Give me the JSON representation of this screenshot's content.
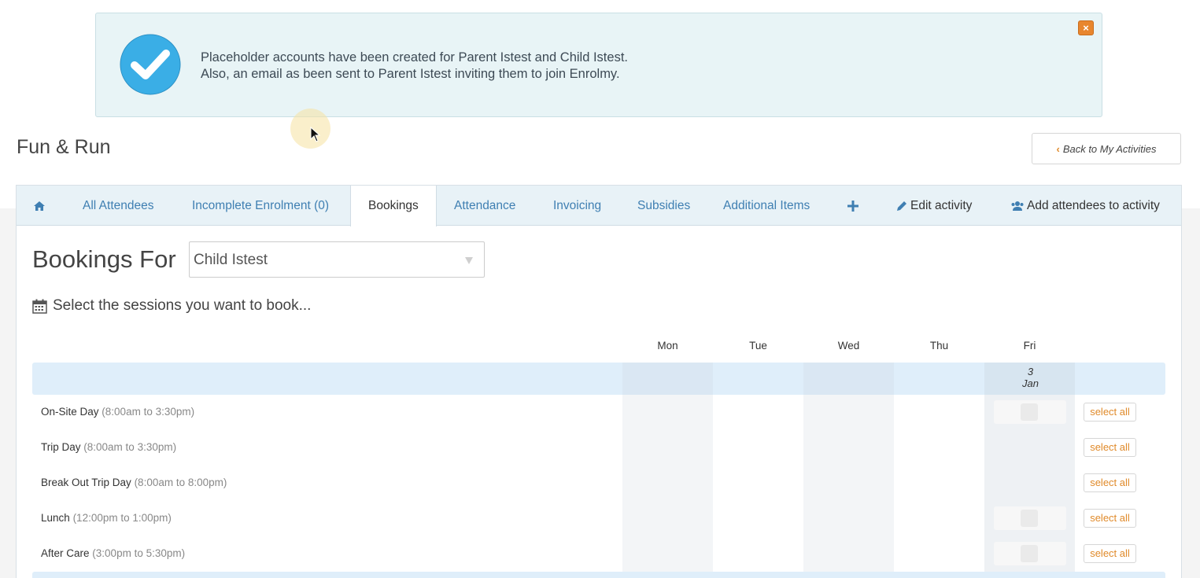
{
  "alert": {
    "line1": "Placeholder accounts have been created for Parent Istest and Child Istest.",
    "line2": "Also, an email as been sent to Parent Istest inviting them to join Enrolmy.",
    "close_label": "×",
    "icon": "check-circle-icon",
    "accent": "#3aaee6"
  },
  "header": {
    "title": "Fun & Run",
    "back_label": "Back to My Activities"
  },
  "tabs": [
    {
      "label": "All Attendees"
    },
    {
      "label": "Incomplete Enrolment (0)"
    },
    {
      "label": "Bookings"
    },
    {
      "label": "Attendance"
    },
    {
      "label": "Invoicing"
    },
    {
      "label": "Subsidies"
    },
    {
      "label": "Additional Items"
    },
    {
      "label": "Edit activity"
    },
    {
      "label": "Add attendees to activity"
    }
  ],
  "bookings": {
    "title": "Bookings For",
    "selected_child": "Child Istest",
    "instruction": "Select the sessions you want to book...",
    "days": [
      "Mon",
      "Tue",
      "Wed",
      "Thu",
      "Fri"
    ],
    "date": {
      "day": "3",
      "month": "Jan"
    },
    "select_all_label": "select all",
    "sessions": [
      {
        "name": "On-Site Day",
        "time": "(8:00am to 3:30pm)"
      },
      {
        "name": "Trip Day",
        "time": "(8:00am to 3:30pm)"
      },
      {
        "name": "Break Out Trip Day",
        "time": "(8:00am to 8:00pm)"
      },
      {
        "name": "Lunch",
        "time": "(12:00pm to 1:00pm)"
      },
      {
        "name": "After Care",
        "time": "(3:00pm to 5:30pm)"
      }
    ]
  },
  "colors": {
    "link": "#3f7fb2",
    "accent_orange": "#e08a2a",
    "alert_bg": "#e8f4f6",
    "tab_bg": "#e8f2f7"
  }
}
